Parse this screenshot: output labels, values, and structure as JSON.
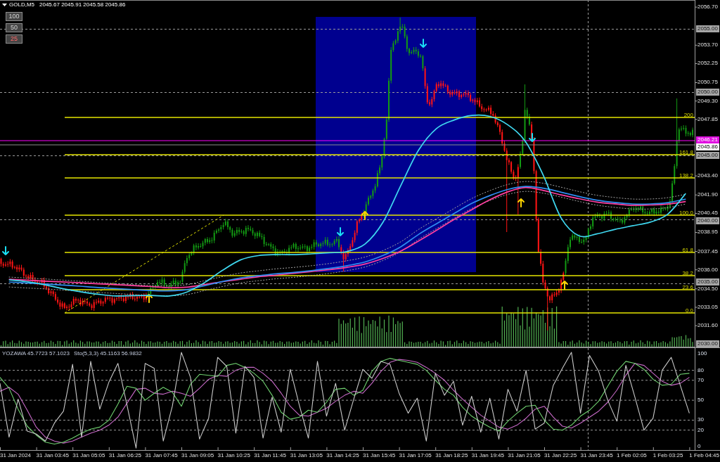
{
  "header": {
    "symbol": "GOLD,M5",
    "quote": "2045.67 2045.91 2045.58 2045.86"
  },
  "scale_buttons": [
    {
      "label": "100",
      "selected": false
    },
    {
      "label": "50",
      "selected": false
    },
    {
      "label": "25",
      "selected": true
    }
  ],
  "price_chart": {
    "fibonacci_levels": [
      "200",
      "161.8",
      "138.2",
      "100.0",
      "61.8",
      "38.2",
      "23.6",
      "0.0"
    ],
    "axis_markers": [
      {
        "label": "2055.00",
        "kind": "level"
      },
      {
        "label": "2050.00",
        "kind": "level"
      },
      {
        "label": "2046.21",
        "kind": "line"
      },
      {
        "label": "2045.86",
        "kind": "bid"
      },
      {
        "label": "2045.00",
        "kind": "level"
      },
      {
        "label": "2040.00",
        "kind": "level"
      },
      {
        "label": "2035.00",
        "kind": "level"
      },
      {
        "label": "2030.00",
        "kind": "level"
      }
    ],
    "chart_data": {
      "type": "line",
      "categories": [
        null,
        null,
        null,
        null,
        null,
        null,
        null,
        null,
        null,
        null,
        null,
        null,
        null,
        null,
        null,
        null,
        null,
        null,
        null,
        null,
        null,
        null,
        null,
        null,
        null,
        null,
        null,
        null,
        null,
        null,
        null,
        null,
        null,
        null,
        null,
        null,
        null,
        null,
        null
      ],
      "ylim": [
        2029.89,
        2057.26
      ],
      "yticks": [
        {
          "value": 2056.7,
          "label": "2056.70"
        },
        {
          "value": 2053.7,
          "label": "2053.70"
        },
        {
          "value": 2052.25,
          "label": "2052.25"
        },
        {
          "value": 2050.75,
          "label": "2050.75"
        },
        {
          "value": 2049.3,
          "label": "2049.30"
        },
        {
          "value": 2047.85,
          "label": "2047.85"
        },
        {
          "value": 2043.4,
          "label": "2043.40"
        },
        {
          "value": 2041.9,
          "label": "2041.90"
        },
        {
          "value": 2040.45,
          "label": "2040.45"
        },
        {
          "value": 2038.95,
          "label": "2038.95"
        },
        {
          "value": 2037.45,
          "label": "2037.45"
        },
        {
          "value": 2036,
          "label": "2036.00"
        },
        {
          "value": 2034.5,
          "label": "2034.50"
        },
        {
          "value": 2033.05,
          "label": "2033.05"
        },
        {
          "value": 2031.6,
          "label": "2031.60"
        }
      ],
      "series": [
        {
          "color": "#a0a0a0",
          "line_style": "dashed",
          "values": [
            2035.43,
            2035.35,
            2035.28,
            2035.19,
            2035.1,
            2035.0,
            2034.92,
            2034.83,
            2034.76,
            2034.73,
            2034.83,
            2035.15,
            2035.47,
            2035.75,
            2035.92,
            2036.08,
            2036.19,
            2036.33,
            2036.5,
            2036.72,
            2037.01,
            2037.52,
            2038.21,
            2039.18,
            2040.02,
            2040.84,
            2041.63,
            2042.24,
            2042.72,
            2042.96,
            2042.82,
            2042.51,
            2042.17,
            2041.88,
            2041.7,
            2041.58,
            2041.58,
            2041.69,
            2041.96
          ]
        },
        {
          "color": "#a0a0a0",
          "line_style": "dashed",
          "values": [
            2034.65,
            2034.57,
            2034.5,
            2034.41,
            2034.32,
            2034.22,
            2034.14,
            2034.05,
            2033.98,
            2033.95,
            2034.05,
            2034.37,
            2034.69,
            2034.97,
            2035.14,
            2035.3,
            2035.41,
            2035.55,
            2035.72,
            2035.94,
            2036.23,
            2036.74,
            2037.43,
            2038.4,
            2039.24,
            2040.06,
            2040.85,
            2041.46,
            2041.94,
            2042.18,
            2042.04,
            2041.73,
            2041.39,
            2041.1,
            2040.92,
            2040.8,
            2040.8,
            2040.91,
            2041.18
          ]
        },
        {
          "color": "#ff3fa0",
          "values": [
            2035.26,
            2035.19,
            2035.11,
            2035.05,
            2034.98,
            2034.9,
            2034.83,
            2034.76,
            2034.68,
            2034.6,
            2034.63,
            2034.85,
            2035.07,
            2035.26,
            2035.45,
            2035.58,
            2035.73,
            2035.87,
            2036.02,
            2036.2,
            2036.46,
            2036.9,
            2037.48,
            2038.27,
            2039.11,
            2039.97,
            2040.75,
            2041.52,
            2042.14,
            2042.49,
            2042.25,
            2041.9,
            2041.61,
            2041.34,
            2041.2,
            2041.09,
            2041.11,
            2041.18,
            2041.38
          ]
        },
        {
          "color": "#2f8cf0",
          "values": [
            2035.04,
            2034.96,
            2034.89,
            2034.8,
            2034.71,
            2034.61,
            2034.53,
            2034.44,
            2034.37,
            2034.34,
            2034.44,
            2034.76,
            2035.08,
            2035.36,
            2035.53,
            2035.69,
            2035.8,
            2035.94,
            2036.11,
            2036.33,
            2036.62,
            2037.13,
            2037.82,
            2038.79,
            2039.63,
            2040.45,
            2041.24,
            2041.85,
            2042.33,
            2042.57,
            2042.43,
            2042.12,
            2041.78,
            2041.49,
            2041.31,
            2041.19,
            2041.19,
            2041.3,
            2041.57
          ]
        },
        {
          "color": "#3fd8f0",
          "values": [
            2035.21,
            2035.06,
            2034.83,
            2034.52,
            2034.28,
            2034.08,
            2033.94,
            2033.97,
            2033.98,
            2033.94,
            2034.25,
            2035.01,
            2035.97,
            2036.78,
            2037.12,
            2037.2,
            2037.2,
            2037.26,
            2037.34,
            2037.45,
            2038.04,
            2039.75,
            2042.64,
            2045.43,
            2047.13,
            2047.81,
            2048.16,
            2048.09,
            2047.43,
            2046.11,
            2043.45,
            2040.09,
            2038.68,
            2038.83,
            2039.18,
            2039.47,
            2039.76,
            2040.4,
            2042.02
          ]
        }
      ]
    }
  },
  "indicator_panel": {
    "legend": [
      "YOZAWA 45.7723 57.1023",
      "Sto(5,3,3) 45.1163 56.9832"
    ],
    "chart_data": {
      "type": "line",
      "grid": true,
      "categories": [
        null,
        null,
        "31 Jan 2024",
        null,
        null,
        null,
        "31 Jan 03:45",
        null,
        null,
        null,
        "31 Jan 05:05",
        null,
        null,
        null,
        "31 Jan 06:25",
        null,
        null,
        null,
        "31 Jan 07:45",
        null,
        null,
        null,
        "31 Jan 09:05",
        null,
        null,
        null,
        "31 Jan 10:25",
        null,
        null,
        null,
        "31 Jan 11:45",
        null,
        null,
        null,
        "31 Jan 13:05",
        null,
        null,
        null,
        "31 Jan 14:25",
        null,
        null,
        null,
        "31 Jan 15:45",
        null,
        null,
        null,
        "31 Jan 17:05",
        null,
        null,
        null,
        "31 Jan 18:25",
        null,
        null,
        null,
        "31 Jan 19:45",
        null,
        null,
        null,
        "31 Jan 21:05",
        null,
        null,
        null,
        "31 Jan 22:25",
        null,
        null,
        null,
        "31 Jan 23:45",
        null,
        null,
        null,
        "1 Feb 02:05",
        null,
        null,
        null,
        "1 Feb 03:25",
        null,
        null,
        null,
        "1 Feb 04:45"
      ],
      "ylim": [
        0,
        100
      ],
      "yticks": [
        {
          "value": 100,
          "label": "100"
        },
        {
          "value": 80,
          "label": "80"
        },
        {
          "value": 70,
          "label": "70"
        },
        {
          "value": 50,
          "label": "50"
        },
        {
          "value": 30,
          "label": "30"
        },
        {
          "value": 20,
          "label": "20"
        },
        {
          "value": 0,
          "label": "0"
        }
      ],
      "series": [
        {
          "color": "#c86ac8",
          "values": [
            59,
            63,
            56,
            40,
            23,
            13,
            9,
            7,
            9,
            13,
            17,
            20,
            25,
            33,
            47,
            61,
            62,
            57,
            56,
            59,
            57,
            54,
            62,
            71,
            75,
            74,
            80,
            83,
            83,
            77,
            69,
            57,
            44,
            35,
            34,
            38,
            42,
            49,
            55,
            59,
            57,
            67,
            79,
            88,
            91,
            90,
            88,
            83,
            77,
            70,
            60,
            51,
            43,
            35,
            29,
            23,
            21,
            25,
            32,
            41,
            44,
            33,
            24,
            22,
            27,
            33,
            39,
            48,
            60,
            75,
            87,
            85,
            77,
            69,
            65,
            67,
            73,
            null,
            null
          ]
        },
        {
          "color": "#6fd06f",
          "values": [
            73,
            62,
            41,
            24,
            15,
            8,
            6,
            8,
            12,
            17,
            21,
            23,
            30,
            46,
            64,
            62,
            50,
            57,
            63,
            58,
            44,
            66,
            76,
            75,
            74,
            85,
            87,
            83,
            77,
            69,
            55,
            38,
            31,
            33,
            40,
            38,
            48,
            61,
            62,
            55,
            60,
            79,
            89,
            92,
            90,
            88,
            86,
            80,
            70,
            61,
            55,
            43,
            34,
            28,
            23,
            19,
            29,
            37,
            44,
            45,
            30,
            21,
            20,
            25,
            34,
            40,
            49,
            64,
            79,
            89,
            87,
            81,
            71,
            65,
            66,
            76,
            77,
            null,
            null
          ]
        },
        {
          "color": "#c8c8c8",
          "values": [
            67,
            13,
            51,
            19,
            16,
            9,
            27,
            39,
            86,
            13,
            89,
            41,
            68,
            87,
            45,
            2,
            87,
            82,
            9,
            44,
            98,
            73,
            11,
            32,
            93,
            84,
            17,
            84,
            73,
            12,
            53,
            18,
            81,
            45,
            12,
            89,
            34,
            67,
            20,
            51,
            81,
            72,
            89,
            86,
            57,
            37,
            52,
            9,
            77,
            55,
            69,
            25,
            54,
            18,
            52,
            11,
            61,
            39,
            80,
            21,
            27,
            65,
            82,
            98,
            37,
            95,
            79,
            50,
            29,
            85,
            53,
            20,
            32,
            80,
            93,
            65,
            37,
            null,
            null
          ]
        }
      ]
    }
  }
}
